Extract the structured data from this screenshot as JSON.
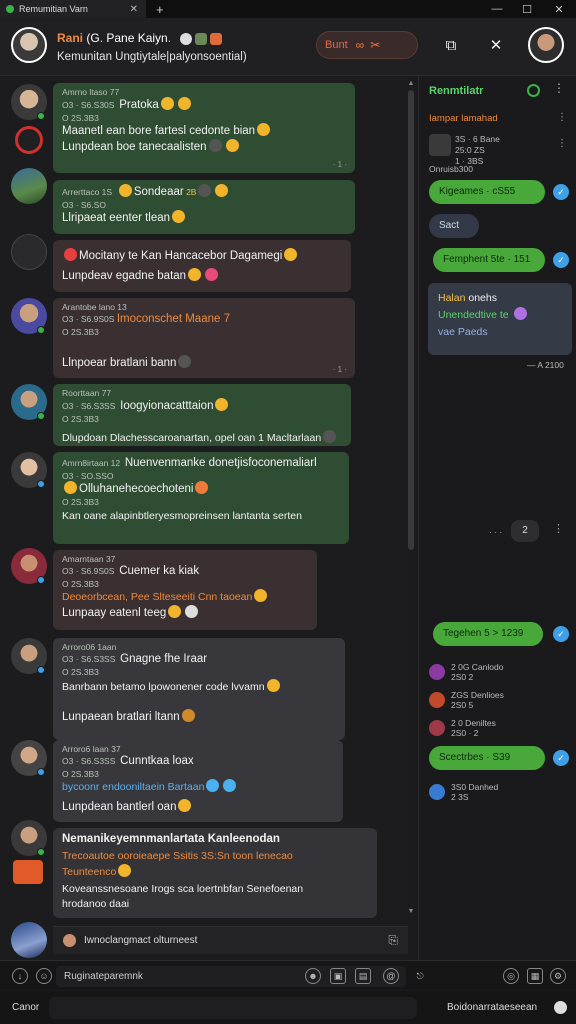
{
  "window": {
    "tab_title": "Remumitian Varn",
    "tab_close": "✕",
    "new_tab": "+",
    "minimize": "—",
    "maximize": "☐",
    "close": "✕"
  },
  "header": {
    "title_highlight": "Rani",
    "title_rest": "(G. Pane Kaiyn.",
    "subtitle": "Kemunitan Ungtiytale|palyonsoential)",
    "action_label": "Bunt",
    "colors": {
      "accent": "#f08a3c",
      "green": "#2f4d32",
      "online": "#3ab34a"
    }
  },
  "messages": [
    {
      "meta1": "Amrno ltaso 77",
      "meta2": "O3 · S6.S30S",
      "meta3": "O 2S.3B3",
      "inline": "Pratoka",
      "line1": "Maanetl ean  bore fartesl  cedonte  bian",
      "line2": "Lunpdean  boe  tanecaalisten",
      "time": "· 1 ·"
    },
    {
      "meta1": "Arrerttaco 1S",
      "meta2": "O3 · S6.SO",
      "inline": "Sondeaar",
      "tag": "2B",
      "line1": "Llripaeat  eenter  tlean",
      "time": ""
    },
    {
      "line1": "Mocitany  te  Kan  Hancacebor  Dagamegi",
      "line2": "Lunpdeav  egadne  batan",
      "time": ""
    },
    {
      "meta1": "Arantobe lano 13",
      "meta2": "O3 · S6.9S0S",
      "meta3": "O 2S.3B3",
      "inline": "Imoconschet Maane 7",
      "line1": "Llnpoear  bratlani  bann",
      "time": "· 1 ·"
    },
    {
      "meta1": "Roorttaan 77",
      "meta2": "O3 · S6.S3SS",
      "meta3": "O 2S.3B3",
      "inline": "Ioogyionacatttaion",
      "line1": "Dlupdoan  Dlachesscaroanartan, opel  oan  1  Macltarlaan",
      "time": ""
    },
    {
      "meta1": "Amrn8irtaan 12",
      "meta2": "O3 · SO.SSO",
      "meta3": "O 2S.3B3",
      "inline": "Nuenvenmanke  donetjisfoconemaliarl",
      "line2": "Olluhanehecoechoteni",
      "line3": "Kan  oane  alapinbtleryesmopreinsen  lantanta  serten",
      "time": ""
    },
    {
      "meta1": "Amarntaan 37",
      "meta2": "O3 · S6.9S0S",
      "meta3": "O 2S.3B3",
      "inline": "Cuemer ka  kiak",
      "line1": "Deoeorbcean,  Pee  Slteseeiti  Cnn  taoean",
      "line2": "Lunpaay  eatenl  teeg",
      "time": ""
    },
    {
      "meta1": "Arroro06 1aan",
      "meta2": "O3 · S6.S3SS",
      "meta3": "O 2S.3B3",
      "inline": "Gnagne  fhe  Iraar",
      "line1": "Banrbann  betamo  lpowonener  code  lvvamn",
      "line2": "Lunpaean  bratlari  ltann",
      "time": ""
    },
    {
      "meta1": "Arroro6 laan 37",
      "meta2": "O3 · S6.S3SS",
      "meta3": "O 2S.3B3",
      "inline": "Cunntkaa loax",
      "line1": "bycoonr  endooniltaein  Bartaan",
      "line2": "Lunpdean  bantlerl  oan",
      "time": ""
    },
    {
      "line1": "Nemanikeyemnmanlartata  Kanleenodan",
      "line2": "Trecoautoe  ooroieaepe    Ssitis  3S:Sn  toon  lenecao",
      "line3": "Teunteenco",
      "line4": "Koveanssnesoane  Irogs  sca  loertnbfan      Senefoenan",
      "line5": "hrodanoo  daai",
      "time": ""
    }
  ],
  "mini_bar": {
    "text": "Iwnoclangmact olturneest"
  },
  "composer": {
    "placeholder": "Ruginateparemnk",
    "left_label": "Canor",
    "right_label": "Boidonarrataeseean"
  },
  "panel": {
    "title": "Renmtilatr",
    "subtitle": "Iampar lamahad",
    "top_meta": [
      "3S · 6 Bane",
      "25:0  ZS",
      "1 · 3BS"
    ],
    "group_label": "Onruisb300",
    "pill1": "Kigeames  ·  cS55",
    "chip": "Sact",
    "pill2": "Femphent  5te · 151",
    "card": {
      "line1a": "Halan",
      "line1b": "onehs",
      "line2": "Unendedtive  te",
      "line3": "vae  Paeds"
    },
    "card_time": "— A 2100",
    "count": "2",
    "dots_left": "· · ·",
    "pill3": "Tegehen  5  >  1239",
    "rows": [
      {
        "a": "2 0G  Canlodo",
        "b": "2S0  2"
      },
      {
        "a": "ZGS  Denlioes",
        "b": "2S0  5"
      },
      {
        "a": "2 0  Deniltes",
        "b": "2S0 · 2"
      }
    ],
    "pill4": "Scectrbes  ·  S39",
    "last_row": {
      "a": "3S0  Danhed",
      "b": "2  3S"
    }
  }
}
